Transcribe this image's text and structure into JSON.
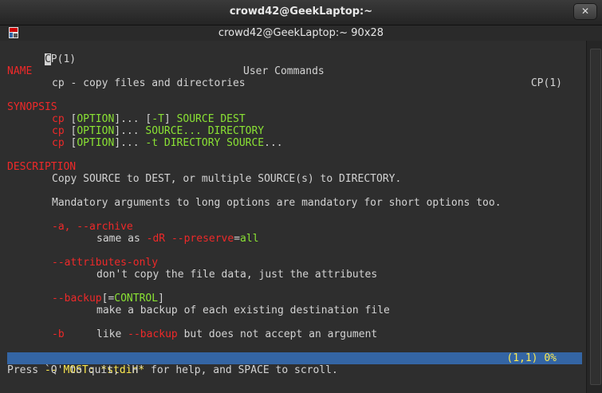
{
  "window": {
    "title": "crowd42@GeekLaptop:~",
    "close_glyph": "✕"
  },
  "terminal_header": {
    "title": "crowd42@GeekLaptop:~ 90x28"
  },
  "man": {
    "header_cursor": "C",
    "header_left_rest": "P(1)",
    "header_center": "User Commands",
    "header_right": "CP(1)",
    "name_heading": "NAME",
    "name_text": "cp - copy files and directories",
    "synopsis_heading": "SYNOPSIS",
    "syn1": {
      "cmd": "cp",
      "b1": "[",
      "opt": "OPTION",
      "b2": "]... [",
      "flag": "-T",
      "b3": "] ",
      "args": "SOURCE DEST"
    },
    "syn2": {
      "cmd": "cp",
      "b1": "[",
      "opt": "OPTION",
      "b2": "]... ",
      "args": "SOURCE... DIRECTORY"
    },
    "syn3": {
      "cmd": "cp",
      "b1": "[",
      "opt": "OPTION",
      "b2": "]... ",
      "args": "-t DIRECTORY SOURCE",
      "tail": "..."
    },
    "description_heading": "DESCRIPTION",
    "desc1": "Copy SOURCE to DEST, or multiple SOURCE(s) to DIRECTORY.",
    "desc2": "Mandatory arguments to long options are mandatory for short options too.",
    "opt_a": "-a, --archive",
    "opt_a_desc_pre": "same as ",
    "opt_a_dR": "-dR",
    "opt_a_preserve": "--preserve",
    "opt_a_eq": "=",
    "opt_a_all": "all",
    "opt_attr": "--attributes-only",
    "opt_attr_desc": "don't copy the file data, just the attributes",
    "opt_backup": "--backup",
    "opt_backup_b1": "[=",
    "opt_backup_ctrl": "CONTROL",
    "opt_backup_b2": "]",
    "opt_backup_desc": "make a backup of each existing destination file",
    "opt_b": "-b",
    "opt_b_desc_pre": "like ",
    "opt_b_backup": "--backup",
    "opt_b_desc_post": " but does not accept an argument"
  },
  "status": {
    "left": "-- MOST: *stdin*",
    "right": "(1,1) 0%"
  },
  "prompt": "Press `Q' to quit, `H' for help, and SPACE to scroll.",
  "colors": {
    "heading": "#ef2929",
    "option": "#8ae234",
    "status_bg": "#3465a4",
    "status_fg": "#fce94f"
  }
}
